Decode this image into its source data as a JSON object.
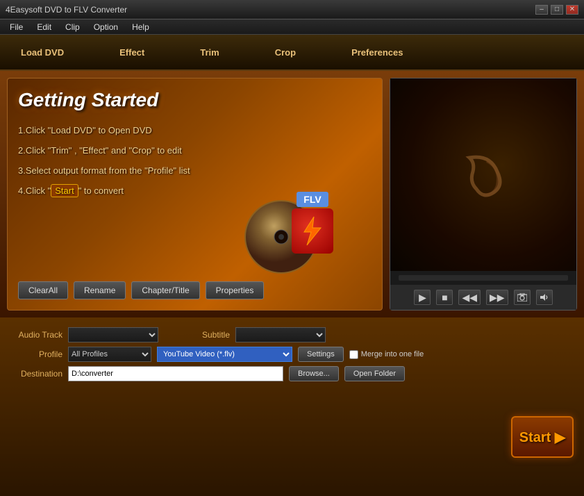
{
  "titlebar": {
    "title": "4Easysoft DVD to FLV Converter",
    "minimize": "–",
    "maximize": "□",
    "close": "✕"
  },
  "menubar": {
    "items": [
      "File",
      "Edit",
      "Clip",
      "Option",
      "Help"
    ]
  },
  "toolbar": {
    "items": [
      "Load DVD",
      "Effect",
      "Trim",
      "Crop",
      "Preferences"
    ]
  },
  "left_panel": {
    "title": "Getting  Started",
    "steps": [
      "1.Click \"Load DVD\" to Open DVD",
      "2.Click \"Trim\" , \"Effect\" and \"Crop\" to edit",
      "3.Select output format from the \"Profile\" list",
      "4.Click \""
    ],
    "step4_end": "\" to convert",
    "start_highlight": "Start",
    "flv_label": "FLV",
    "buttons": {
      "clear_all": "ClearAll",
      "rename": "Rename",
      "chapter_title": "Chapter/Title",
      "properties": "Properties"
    }
  },
  "bottom": {
    "audio_track_label": "Audio Track",
    "subtitle_label": "Subtitle",
    "profile_label": "Profile",
    "destination_label": "Destination",
    "profile_category": "All Profiles",
    "profile_format": "YouTube Video (*.flv)",
    "settings_btn": "Settings",
    "merge_label": "Merge into one file",
    "destination_path": "D:\\converter",
    "browse_btn": "Browse...",
    "open_folder_btn": "Open Folder",
    "start_btn": "Start ▶"
  },
  "video_controls": {
    "play": "▶",
    "stop": "■",
    "rewind": "◀◀",
    "forward": "▶▶",
    "screenshot": "📷",
    "volume": "🔊"
  }
}
